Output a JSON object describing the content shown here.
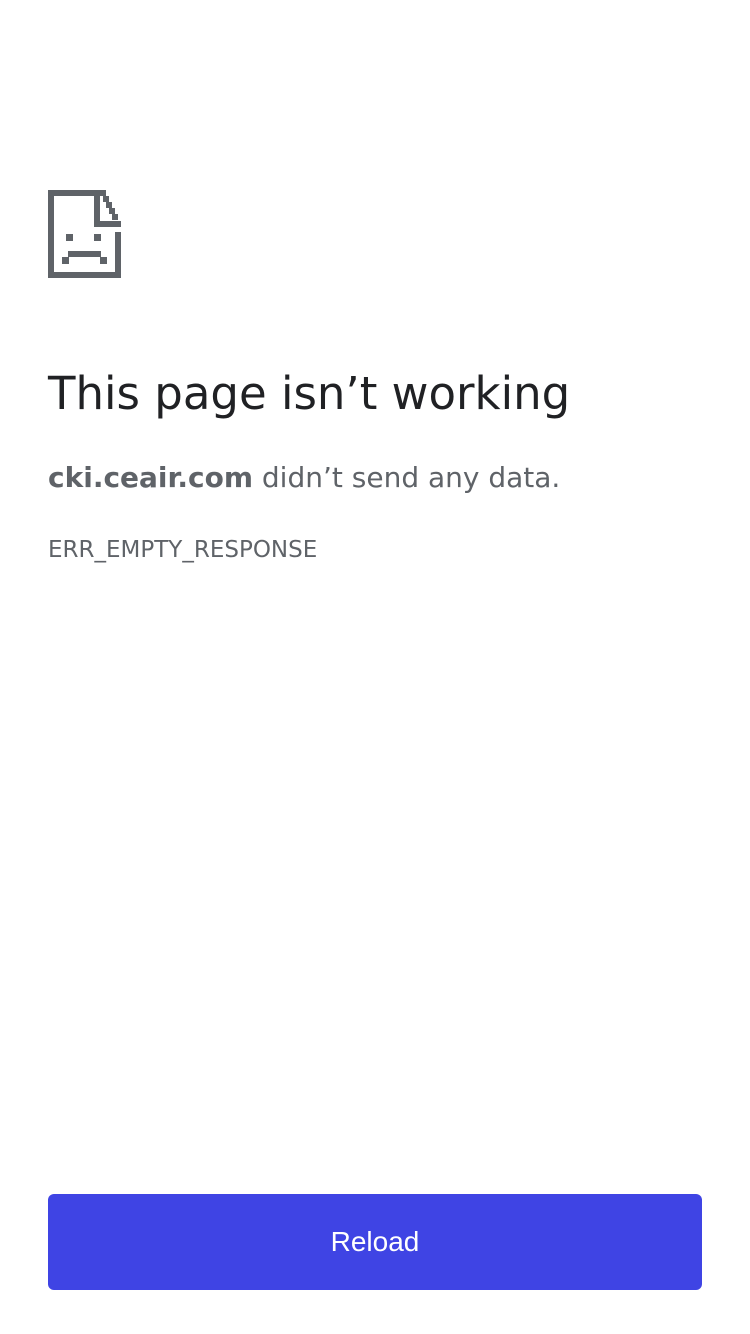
{
  "error": {
    "icon": "sad-page-icon",
    "title": "This page isn’t working",
    "host": "cki.ceair.com",
    "message": "didn’t send any data.",
    "code": "ERR_EMPTY_RESPONSE"
  },
  "actions": {
    "reload_label": "Reload"
  },
  "colors": {
    "accent": "#3f44e4",
    "title_text": "#202124",
    "secondary_text": "#5f6368",
    "icon": "#5f6368"
  }
}
